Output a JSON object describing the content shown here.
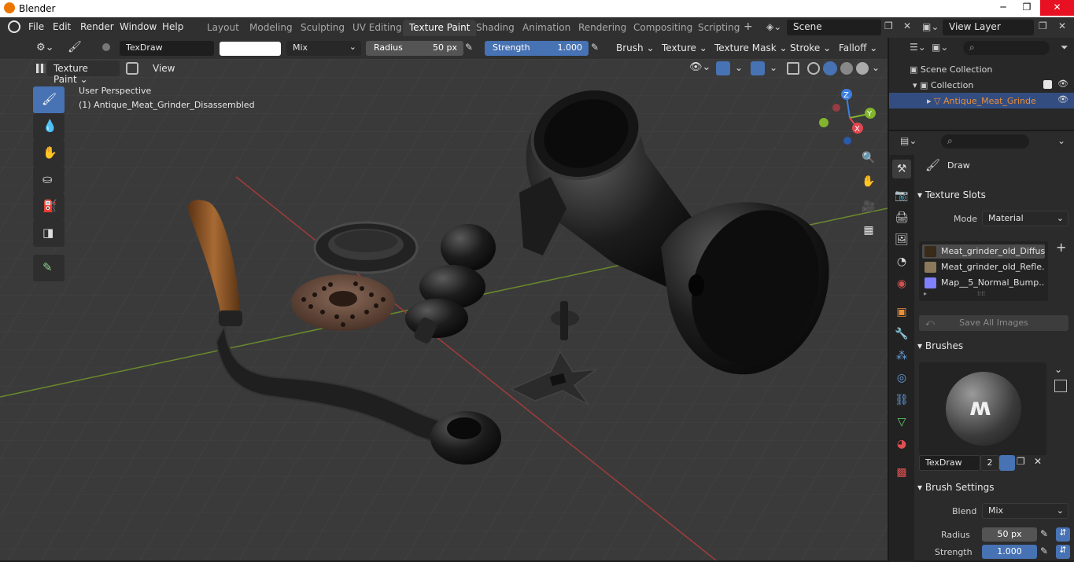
{
  "window": {
    "title": "Blender"
  },
  "menus": [
    "File",
    "Edit",
    "Render",
    "Window",
    "Help"
  ],
  "workspaces": [
    "Layout",
    "Modeling",
    "Sculpting",
    "UV Editing",
    "Texture Paint",
    "Shading",
    "Animation",
    "Rendering",
    "Compositing",
    "Scripting"
  ],
  "scene": {
    "name": "Scene",
    "view_layer": "View Layer"
  },
  "tool_header": {
    "brush_name": "TexDraw",
    "blend": "Mix",
    "radius_label": "Radius",
    "radius_value": "50 px",
    "strength_label": "Strength",
    "strength_value": "1.000",
    "strength_fraction": 1.0,
    "menus": [
      "Brush",
      "Texture",
      "Texture Mask",
      "Stroke",
      "Falloff"
    ]
  },
  "viewport": {
    "mode": "Texture Paint",
    "view_menu": "View",
    "perspective": "User Perspective",
    "object_label": "(1) Antique_Meat_Grinder_Disassembled",
    "axes": {
      "z": "Z",
      "y": "Y",
      "x": "X"
    }
  },
  "outliner": {
    "scene_collection": "Scene Collection",
    "collection": "Collection",
    "object": "Antique_Meat_Grinde"
  },
  "properties": {
    "tool_name": "Draw",
    "texture_slots": {
      "header": "Texture Slots",
      "mode_label": "Mode",
      "mode_value": "Material",
      "slots": [
        "Meat_grinder_old_Diffus...",
        "Meat_grinder_old_Refle...",
        "Map__5_Normal_Bump..."
      ],
      "save_all": "Save All Images"
    },
    "brushes": {
      "header": "Brushes",
      "brush_name": "TexDraw",
      "users": "2"
    },
    "brush_settings": {
      "header": "Brush Settings",
      "blend_label": "Blend",
      "blend_value": "Mix",
      "radius_label": "Radius",
      "radius_value": "50 px",
      "strength_label": "Strength",
      "strength_value": "1.000"
    }
  },
  "colors": {
    "accent": "#4772b3",
    "active_object": "#e98e3a",
    "x_axis": "#e04651",
    "y_axis": "#82b52d",
    "z_axis": "#3d7fe0"
  }
}
